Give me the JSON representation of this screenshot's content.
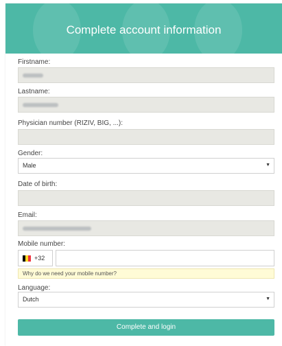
{
  "header": {
    "title": "Complete account information"
  },
  "form": {
    "firstname_label": "Firstname:",
    "lastname_label": "Lastname:",
    "physician_label": "Physician number (RIZIV, BIG, ...):",
    "gender_label": "Gender:",
    "gender_value": "Male",
    "dob_label": "Date of birth:",
    "email_label": "Email:",
    "mobile_label": "Mobile number:",
    "country_code": "+32",
    "mobile_hint": "Why do we need your mobile number?",
    "language_label": "Language:",
    "language_value": "Dutch",
    "submit_label": "Complete and login"
  },
  "colors": {
    "accent": "#4db8a6",
    "hint_bg": "#fffbd6",
    "readonly_bg": "#e8e8e3"
  },
  "icons": {
    "flag": "belgium-flag-icon",
    "select_caret": "caret-down-icon"
  }
}
